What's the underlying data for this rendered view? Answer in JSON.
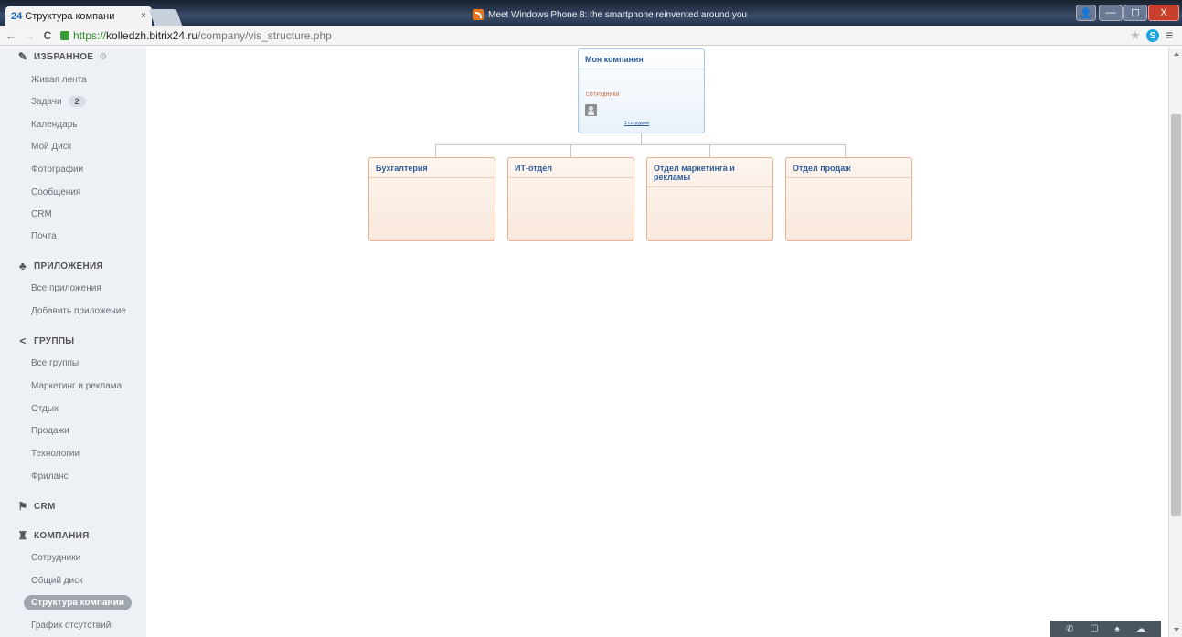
{
  "browser": {
    "tab_num": "24",
    "tab_title": "Структура компани",
    "tab_close": "×",
    "window_title": "Meet Windows Phone 8: the smartphone reinvented around you",
    "url_scheme": "https://",
    "url_host": "kolledzh.bitrix24.ru",
    "url_path": "/company/vis_structure.php",
    "nav": {
      "back": "←",
      "forward": "→",
      "reload": "C"
    },
    "controls": {
      "person": "👤",
      "minimize": "—",
      "maximize": "☐",
      "close": "X"
    },
    "icons": {
      "star": "★",
      "skype": "S",
      "menu": "≡"
    }
  },
  "sidebar": {
    "favorites_header": "ИЗБРАННОЕ",
    "favorites_gear": "⚙",
    "favorites": [
      "Живая лента",
      "Задачи",
      "Календарь",
      "Мой Диск",
      "Фотографии",
      "Сообщения",
      "CRM",
      "Почта"
    ],
    "tasks_badge": "2",
    "apps_header": "ПРИЛОЖЕНИЯ",
    "apps": [
      "Все приложения",
      "Добавить приложение"
    ],
    "groups_header": "ГРУППЫ",
    "groups": [
      "Все группы",
      "Маркетинг и реклама",
      "Отдых",
      "Продажи",
      "Технологии",
      "Фриланс"
    ],
    "crm_header": "CRM",
    "company_header": "КОМПАНИЯ",
    "company": [
      "Сотрудники",
      "Общий диск",
      "Структура компании",
      "График отсутствий"
    ]
  },
  "org_chart": {
    "root": {
      "title": "Моя компания",
      "employees_label": "сотрудники",
      "employees_link": "1 сотрудник"
    },
    "departments": [
      "Бухгалтерия",
      "ИТ-отдел",
      "Отдел маркетинга и рекламы",
      "Отдел продаж"
    ]
  },
  "dock": {
    "phone": "✆",
    "chat": "☐",
    "bell": "♠",
    "cloud": "☁"
  },
  "colors": {
    "root_border": "#a8c6e2",
    "dept_border": "#e9b18f",
    "title_text": "#2e5c9a",
    "sidebar_bg": "#edf0f4",
    "active_item": "#9ea5ae"
  }
}
